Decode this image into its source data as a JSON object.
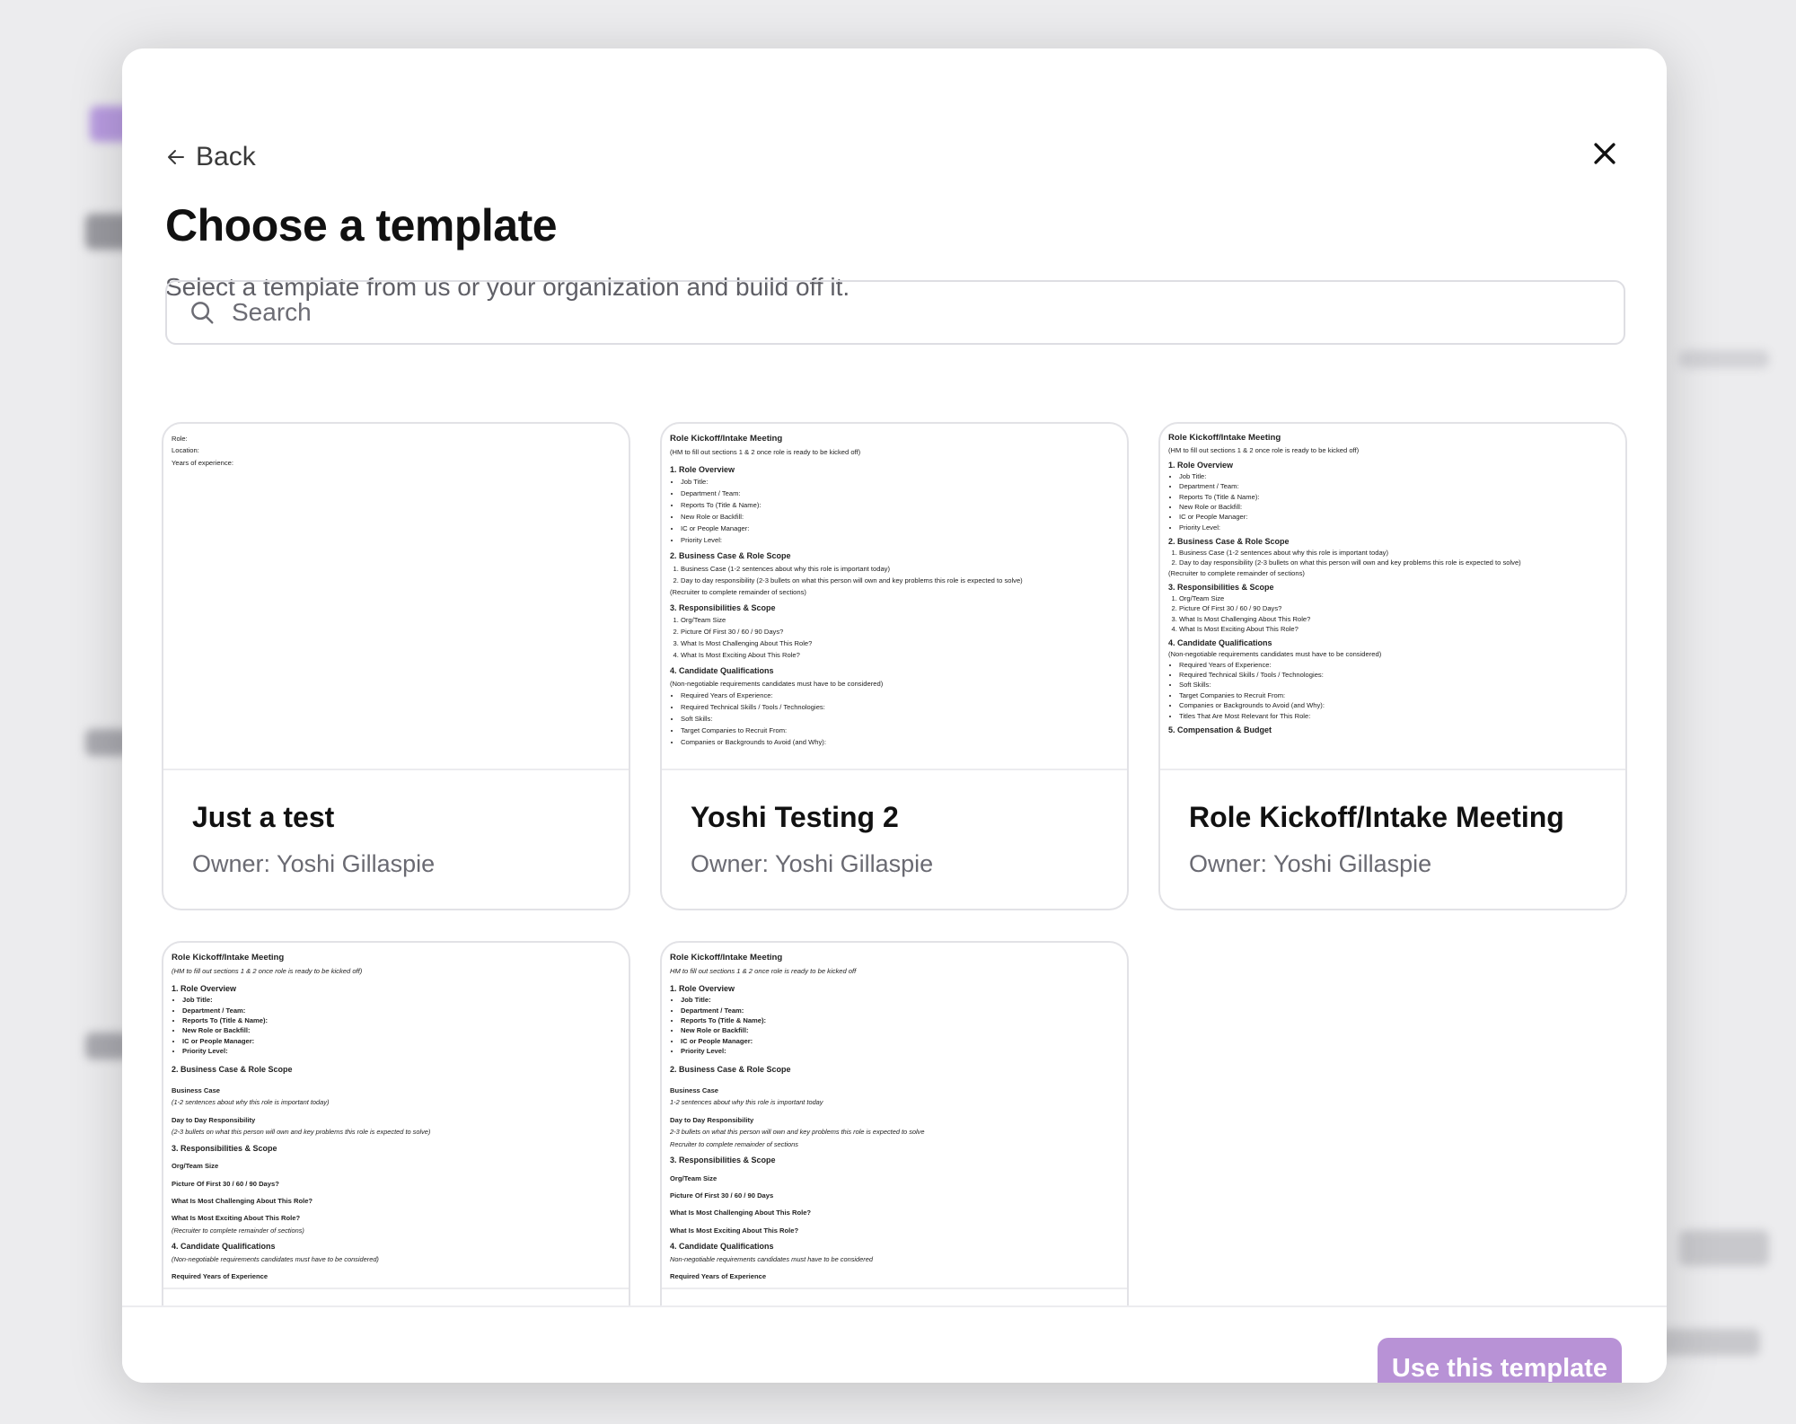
{
  "modal": {
    "back_label": "Back",
    "title": "Choose a template",
    "subtitle": "Select a template from us or your organization and build off it.",
    "search_placeholder": "Search",
    "use_button_label": "Use this template"
  },
  "cards": [
    {
      "title": "Just a test",
      "owner": "Owner: Yoshi Gillaspie",
      "preview_lines": [
        "Role:",
        "Location:",
        "Years of experience:"
      ]
    },
    {
      "title": "Yoshi Testing 2",
      "owner": "Owner: Yoshi Gillaspie",
      "preview": {
        "heading": "Role Kickoff/Intake Meeting",
        "sub": "(HM to fill out sections 1 & 2 once role is ready to be kicked off)",
        "s1": "1. Role Overview",
        "s1_items": [
          "Job Title:",
          "Department / Team:",
          "Reports To (Title & Name):",
          "New Role or Backfill:",
          "IC or People Manager:",
          "Priority Level:"
        ],
        "s2": "2. Business Case & Role Scope",
        "s2_items": [
          "Business Case (1-2 sentences about why this role is important today)",
          "Day to day responsibility (2-3 bullets on what this person will own and key problems this role is expected to solve)"
        ],
        "s2_note": "(Recruiter to complete remainder of sections)",
        "s3": "3. Responsibilities & Scope",
        "s3_items": [
          "Org/Team Size",
          "Picture Of First 30 / 60 / 90 Days?",
          "What Is Most Challenging About This Role?",
          "What Is Most Exciting About This Role?"
        ],
        "s4": "4. Candidate Qualifications",
        "s4_note": "(Non-negotiable requirements candidates must have to be considered)",
        "s4_items": [
          "Required Years of Experience:",
          "Required Technical Skills / Tools / Technologies:",
          "Soft Skills:",
          "Target Companies to Recruit From:",
          "Companies or Backgrounds to Avoid (and Why):"
        ]
      }
    },
    {
      "title": "Role Kickoff/Intake Meeting",
      "owner": "Owner: Yoshi Gillaspie",
      "preview": {
        "heading": "Role Kickoff/Intake Meeting",
        "sub": "(HM to fill out sections 1 & 2 once role is ready to be kicked off)",
        "s1": "1. Role Overview",
        "s1_items": [
          "Job Title:",
          "Department / Team:",
          "Reports To (Title & Name):",
          "New Role or Backfill:",
          "IC or People Manager:",
          "Priority Level:"
        ],
        "s2": "2. Business Case & Role Scope",
        "s2_items": [
          "Business Case (1-2 sentences about why this role is important today)",
          "Day to day responsibility (2-3 bullets on what this person will own and key problems this role is expected to solve)"
        ],
        "s2_note": "(Recruiter to complete remainder of sections)",
        "s3": "3. Responsibilities & Scope",
        "s3_items": [
          "Org/Team Size",
          "Picture Of First 30 / 60 / 90 Days?",
          "What Is Most Challenging About This Role?",
          "What Is Most Exciting About This Role?"
        ],
        "s4": "4. Candidate Qualifications",
        "s4_note": "(Non-negotiable requirements candidates must have to be considered)",
        "s4_items": [
          "Required Years of Experience:",
          "Required Technical Skills / Tools / Technologies:",
          "Soft Skills:",
          "Target Companies to Recruit From:",
          "Companies or Backgrounds to Avoid (and Why):",
          "Titles That Are Most Relevant for This Role:"
        ],
        "s5": "5. Compensation & Budget"
      }
    },
    {
      "preview": {
        "heading": "Role Kickoff/Intake Meeting",
        "sub": "(HM to fill out sections 1 & 2 once role is ready to be kicked off)",
        "s1": "1. Role Overview",
        "s1_items": [
          "Job Title:",
          "Department / Team:",
          "Reports To (Title & Name):",
          "New Role or Backfill:",
          "IC or People Manager:",
          "Priority Level:"
        ],
        "s2": "2. Business Case & Role Scope",
        "b1": "Business Case",
        "b1_note": "(1-2 sentences about why this role is important today)",
        "b2": "Day to Day Responsibility",
        "b2_note": "(2-3 bullets on what this person will own and key problems this role is expected to solve)",
        "s3": "3. Responsibilities & Scope",
        "b3": "Org/Team Size",
        "b4": "Picture Of First 30 / 60 / 90 Days?",
        "b5": "What Is Most Challenging About This Role?",
        "b6": "What Is Most Exciting About This Role?",
        "b6_note": "(Recruiter to complete remainder of sections)",
        "s4": "4. Candidate Qualifications",
        "s4_note": "(Non-negotiable requirements candidates must have to be considered)",
        "b7": "Required Years of Experience"
      }
    },
    {
      "preview": {
        "heading": "Role Kickoff/Intake Meeting",
        "sub": "HM to fill out sections 1 & 2 once role is ready to be kicked off",
        "s1": "1. Role Overview",
        "s1_items": [
          "Job Title:",
          "Department / Team:",
          "Reports To (Title & Name):",
          "New Role or Backfill:",
          "IC or People Manager:",
          "Priority Level:"
        ],
        "s2": "2. Business Case & Role Scope",
        "b1": "Business Case",
        "b1_note": "1-2 sentences about why this role is important today",
        "b2": "Day to Day Responsibility",
        "b2_note": "2-3 bullets on what this person will own and key problems this role is expected to solve",
        "b2_note2": "Recruiter to complete remainder of sections",
        "s3": "3. Responsibilities & Scope",
        "b3": "Org/Team Size",
        "b4": "Picture Of First 30 / 60 / 90 Days",
        "b5": "What Is Most Challenging About This Role?",
        "b6": "What Is Most Exciting About This Role?",
        "s4": "4. Candidate Qualifications",
        "s4_note": "Non-negotiable requirements candidates must have to be considered",
        "b7": "Required Years of Experience"
      }
    }
  ]
}
